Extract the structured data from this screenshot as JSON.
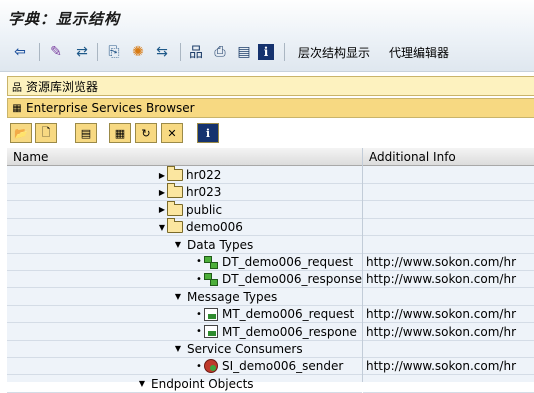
{
  "window": {
    "title": "字典：显示结构"
  },
  "toolbar": {
    "icons": [
      "back-icon",
      "edit-icon",
      "toggle-icon",
      "where-used-icon",
      "activate-icon",
      "navigate-icon",
      "hierarchy-icon",
      "print-icon",
      "list-icon",
      "info-icon"
    ],
    "hierarchy_label": "层次结构显示",
    "proxy_editor_label": "代理编辑器"
  },
  "panels": {
    "repository_browser": "资源库浏览器",
    "enterprise_services_browser": "Enterprise Services Browser"
  },
  "columns": {
    "name": "Name",
    "info": "Additional Info"
  },
  "tree": {
    "rows": [
      {
        "label": "hr022",
        "info": ""
      },
      {
        "label": "hr023",
        "info": ""
      },
      {
        "label": "public",
        "info": ""
      },
      {
        "label": "demo006",
        "info": ""
      },
      {
        "label": "Data Types",
        "info": ""
      },
      {
        "label": "DT_demo006_request",
        "info": "http://www.sokon.com/hr"
      },
      {
        "label": "DT_demo006_response",
        "info": "http://www.sokon.com/hr"
      },
      {
        "label": "Message Types",
        "info": ""
      },
      {
        "label": "MT_demo006_request",
        "info": "http://www.sokon.com/hr"
      },
      {
        "label": "MT_demo006_respone",
        "info": "http://www.sokon.com/hr"
      },
      {
        "label": "Service Consumers",
        "info": ""
      },
      {
        "label": "SI_demo006_sender",
        "info": "http://www.sokon.com/hr"
      },
      {
        "label": "Endpoint Objects",
        "info": ""
      }
    ]
  }
}
